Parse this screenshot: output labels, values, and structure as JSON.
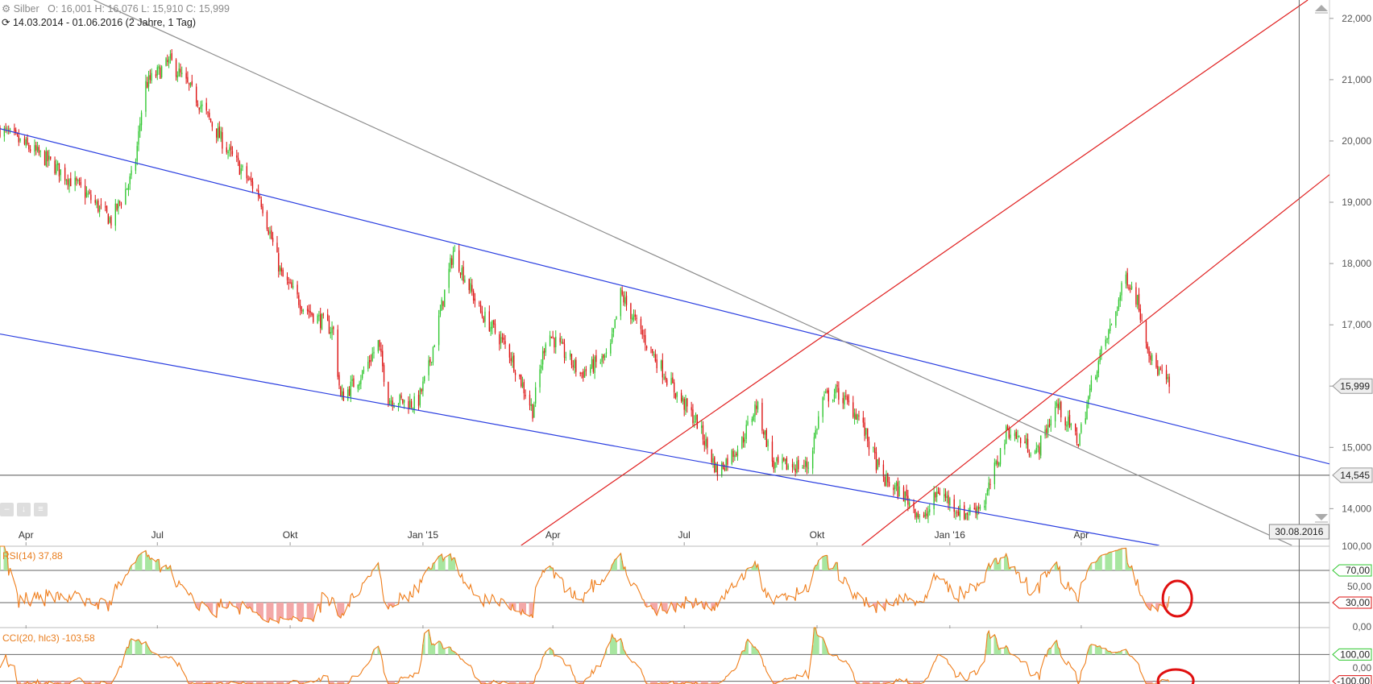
{
  "header": {
    "instrument": "Silber",
    "ohlc": "O: 16,001  H: 16,076  L: 15,910  C: 15,999",
    "period": "14.03.2014 - 01.06.2016 (2 Jahre, 1 Tag)"
  },
  "colors": {
    "up": "#2fc72f",
    "down": "#dd1111",
    "channel": "#2a3ee0",
    "trend_red": "#e02020",
    "trend_gray": "#8c8c8c",
    "indicator": "#ef7d1a",
    "grid": "#9a9a9a"
  },
  "chart_data": [
    {
      "type": "candlestick",
      "title": "Silber",
      "x_range": [
        "2014-03-14",
        "2016-09-20"
      ],
      "ylim": [
        13400,
        22300
      ],
      "y_ticks": [
        {
          "value": 14000,
          "label": "14,000"
        },
        {
          "value": 15000,
          "label": "15,000"
        },
        {
          "value": 16000,
          "label": "16,000"
        },
        {
          "value": 17000,
          "label": "17,000"
        },
        {
          "value": 18000,
          "label": "18,000"
        },
        {
          "value": 19000,
          "label": "19,000"
        },
        {
          "value": 20000,
          "label": "20,000"
        },
        {
          "value": 21000,
          "label": "21,000"
        },
        {
          "value": 22000,
          "label": "22,000"
        }
      ],
      "x_ticks": [
        {
          "date": "2014-04-01",
          "label": "Apr"
        },
        {
          "date": "2014-07-01",
          "label": "Jul"
        },
        {
          "date": "2014-10-01",
          "label": "Okt"
        },
        {
          "date": "2015-01-01",
          "label": "Jan '15"
        },
        {
          "date": "2015-04-01",
          "label": "Apr"
        },
        {
          "date": "2015-07-01",
          "label": "Jul"
        },
        {
          "date": "2015-10-01",
          "label": "Okt"
        },
        {
          "date": "2016-01-01",
          "label": "Jan '16"
        },
        {
          "date": "2016-04-01",
          "label": "Apr"
        }
      ],
      "close_path": [
        {
          "date": "2014-03-14",
          "close": 20200
        },
        {
          "date": "2014-04-15",
          "close": 19700
        },
        {
          "date": "2014-05-10",
          "close": 19200
        },
        {
          "date": "2014-05-30",
          "close": 18700
        },
        {
          "date": "2014-06-15",
          "close": 19500
        },
        {
          "date": "2014-06-22",
          "close": 20900
        },
        {
          "date": "2014-07-10",
          "close": 21300
        },
        {
          "date": "2014-07-28",
          "close": 20700
        },
        {
          "date": "2014-08-20",
          "close": 19800
        },
        {
          "date": "2014-09-10",
          "close": 19100
        },
        {
          "date": "2014-09-25",
          "close": 17800
        },
        {
          "date": "2014-10-10",
          "close": 17300
        },
        {
          "date": "2014-10-31",
          "close": 16900
        },
        {
          "date": "2014-11-05",
          "close": 15800
        },
        {
          "date": "2014-11-20",
          "close": 16200
        },
        {
          "date": "2014-12-01",
          "close": 16700
        },
        {
          "date": "2014-12-08",
          "close": 15800
        },
        {
          "date": "2014-12-28",
          "close": 15700
        },
        {
          "date": "2015-01-05",
          "close": 16300
        },
        {
          "date": "2015-01-22",
          "close": 18200
        },
        {
          "date": "2015-02-10",
          "close": 17200
        },
        {
          "date": "2015-03-01",
          "close": 16600
        },
        {
          "date": "2015-03-18",
          "close": 15600
        },
        {
          "date": "2015-03-28",
          "close": 16900
        },
        {
          "date": "2015-04-20",
          "close": 16200
        },
        {
          "date": "2015-05-10",
          "close": 16500
        },
        {
          "date": "2015-05-18",
          "close": 17500
        },
        {
          "date": "2015-06-05",
          "close": 16700
        },
        {
          "date": "2015-06-25",
          "close": 15900
        },
        {
          "date": "2015-07-10",
          "close": 15400
        },
        {
          "date": "2015-07-24",
          "close": 14600
        },
        {
          "date": "2015-08-10",
          "close": 15100
        },
        {
          "date": "2015-08-20",
          "close": 15700
        },
        {
          "date": "2015-09-01",
          "close": 14700
        },
        {
          "date": "2015-09-25",
          "close": 14700
        },
        {
          "date": "2015-10-05",
          "close": 15800
        },
        {
          "date": "2015-10-15",
          "close": 15900
        },
        {
          "date": "2015-10-30",
          "close": 15500
        },
        {
          "date": "2015-11-15",
          "close": 14500
        },
        {
          "date": "2015-12-01",
          "close": 14200
        },
        {
          "date": "2015-12-14",
          "close": 13800
        },
        {
          "date": "2015-12-24",
          "close": 14300
        },
        {
          "date": "2016-01-10",
          "close": 13900
        },
        {
          "date": "2016-01-25",
          "close": 14100
        },
        {
          "date": "2016-02-10",
          "close": 15300
        },
        {
          "date": "2016-03-01",
          "close": 14900
        },
        {
          "date": "2016-03-15",
          "close": 15700
        },
        {
          "date": "2016-03-30",
          "close": 15100
        },
        {
          "date": "2016-04-10",
          "close": 16200
        },
        {
          "date": "2016-04-22",
          "close": 17000
        },
        {
          "date": "2016-05-02",
          "close": 17800
        },
        {
          "date": "2016-05-10",
          "close": 17400
        },
        {
          "date": "2016-05-20",
          "close": 16400
        },
        {
          "date": "2016-06-01",
          "close": 15999
        }
      ],
      "trendlines": [
        {
          "color": "channel",
          "from": {
            "date": "2014-03-14",
            "value": 20200
          },
          "to": {
            "date": "2016-09-20",
            "value": 14730
          }
        },
        {
          "color": "channel",
          "from": {
            "date": "2014-03-14",
            "value": 16850
          },
          "to": {
            "date": "2016-05-25",
            "value": 13400
          }
        },
        {
          "color": "trend_gray",
          "from": {
            "date": "2014-05-18",
            "value": 22300
          },
          "to": {
            "date": "2016-08-25",
            "value": 13400
          }
        },
        {
          "color": "trend_red",
          "from": {
            "date": "2015-03-10",
            "value": 13400
          },
          "to": {
            "date": "2016-09-05",
            "value": 22300
          }
        },
        {
          "color": "trend_red",
          "from": {
            "date": "2015-11-01",
            "value": 13400
          },
          "to": {
            "date": "2016-09-20",
            "value": 19450
          }
        }
      ],
      "horizontal_line": {
        "value": 14545,
        "label": "14,545"
      },
      "last_price": {
        "value": 15999,
        "label": "15,999"
      },
      "crosshair": {
        "date": "2016-08-30",
        "label": "30.08.2016"
      }
    },
    {
      "type": "line",
      "title": "RSI(14)",
      "label": "RSI(14)  37,88",
      "ylim": [
        0,
        100
      ],
      "y_ticks": [
        {
          "value": 0,
          "label": "0,00"
        },
        {
          "value": 50,
          "label": "50,00"
        },
        {
          "value": 100,
          "label": "100,00"
        }
      ],
      "levels": [
        {
          "value": 70,
          "label": "70,00"
        },
        {
          "value": 30,
          "label": "30,00"
        }
      ],
      "last_value": 37.88
    },
    {
      "type": "line",
      "title": "CCI(20, hlc3)",
      "label": "CCI(20, hlc3)  -103,58",
      "ylim": [
        -120,
        300
      ],
      "y_ticks": [
        {
          "value": 0,
          "label": "0,00"
        }
      ],
      "levels": [
        {
          "value": 100,
          "label": "100,00"
        },
        {
          "value": -100,
          "label": "-100,00"
        }
      ],
      "last_value": -103.58
    }
  ]
}
